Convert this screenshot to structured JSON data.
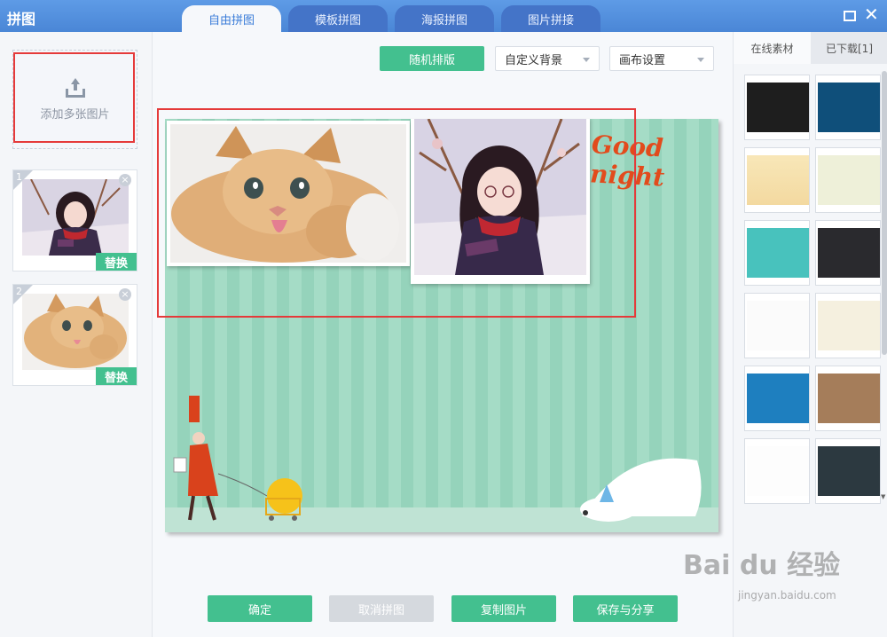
{
  "app": {
    "title": "拼图"
  },
  "tabs": [
    {
      "label": "自由拼图",
      "active": true
    },
    {
      "label": "模板拼图",
      "active": false
    },
    {
      "label": "海报拼图",
      "active": false
    },
    {
      "label": "图片拼接",
      "active": false
    }
  ],
  "left_panel": {
    "add_label": "添加多张图片",
    "thumbs": [
      {
        "index": "1",
        "replace_label": "替换",
        "icon": "anime-girl-image"
      },
      {
        "index": "2",
        "replace_label": "替换",
        "icon": "kitten-image"
      }
    ],
    "delete_icon": "×"
  },
  "toolbar": {
    "random_label": "随机排版",
    "background_label": "自定义背景",
    "canvas_label": "画布设置"
  },
  "canvas": {
    "text": "Good night",
    "colors": {
      "stripe_light": "#a5dcc6",
      "stripe_dark": "#95d3bb",
      "text": "#e24b1c"
    }
  },
  "buttons": {
    "confirm": "确定",
    "cancel": "取消拼图",
    "copy": "复制图片",
    "save_share": "保存与分享"
  },
  "right_panel": {
    "tab_online": "在线素材",
    "tab_downloaded": "已下载[1]"
  },
  "watermark": {
    "text": "Bai du 经验",
    "sub": "jingyan.baidu.com"
  },
  "colors": {
    "accent": "#43c08f",
    "titlebar": "#4a86d6",
    "highlight": "#e53a3a"
  }
}
